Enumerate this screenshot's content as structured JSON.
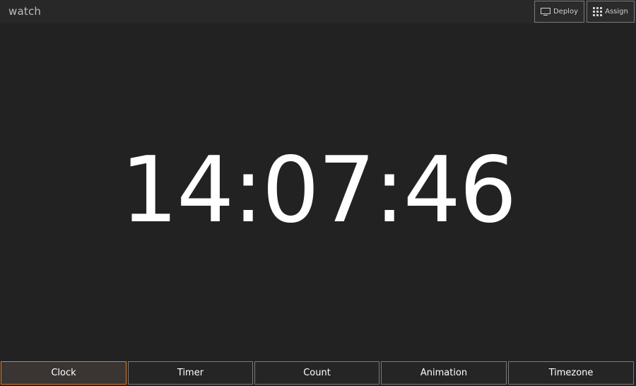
{
  "header": {
    "title": "watch",
    "deploy": {
      "label": "Deploy",
      "icon": "monitor-icon"
    },
    "assign": {
      "label": "Assign",
      "icon": "grid-icon"
    }
  },
  "clock": {
    "time": "14:07:46"
  },
  "tabs": [
    {
      "label": "Clock",
      "active": true
    },
    {
      "label": "Timer",
      "active": false
    },
    {
      "label": "Count",
      "active": false
    },
    {
      "label": "Animation",
      "active": false
    },
    {
      "label": "Timezone",
      "active": false
    }
  ],
  "colors": {
    "background": "#222222",
    "header": "#282828",
    "accent": "#e07b2a",
    "border": "#7a7a7a",
    "text": "#ffffff"
  }
}
